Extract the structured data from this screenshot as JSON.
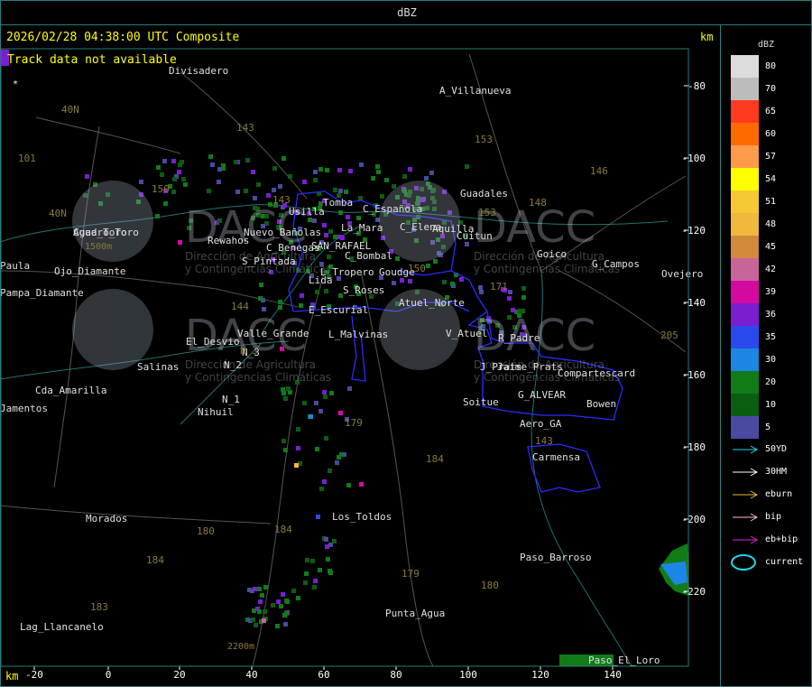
{
  "header": {
    "title": "dBZ"
  },
  "map": {
    "timestamp": "2026/02/28 04:38:00 UTC Composite",
    "track_message": "Track data not available",
    "km_unit": "km",
    "watermark": {
      "brand": "DACC",
      "line1": "Dirección de Agricultura",
      "line2": "y Contingencias Climáticas"
    },
    "x_ticks": [
      "-20",
      "0",
      "20",
      "40",
      "60",
      "80",
      "100",
      "120",
      "140"
    ],
    "y_ticks": [
      "-80",
      "-100",
      "-120",
      "-140",
      "-160",
      "-180",
      "-200",
      "-220"
    ],
    "places": [
      "Divisadero",
      "A_Villanueva",
      "Guadales",
      "Tomba",
      "Usilla",
      "C_Española",
      "La_Mara",
      "C_Elena",
      "Cuadro_Toro",
      "Nuevo_Bañolas",
      "Rewahos",
      "S_Pintada",
      "C_Benegas",
      "SAN_RAFAEL",
      "C_Bombal",
      "Goudge",
      "Lida",
      "L_Tropero",
      "S_Roses",
      "Atuel_Norte",
      "E_Escurial",
      "Valle_Grande",
      "L_Malvinas",
      "V_Atuel",
      "R_Padre",
      "J_Prats",
      "Compartescard",
      "G_ALVEAR",
      "Bowen",
      "Soitue",
      "Aero_GA",
      "Carmensa",
      "El_Desvio",
      "Salinas",
      "N_3",
      "N_2",
      "N_1",
      "Nihuil",
      "Cda_Amarilla",
      "Jamentos",
      "Pampa_Diamante",
      "Paula",
      "Agua_Toro",
      "Ojo_Diamante",
      "Morados",
      "Los_Toldos",
      "Paso_Barroso",
      "Punta_Agua",
      "Paso_El_Loro",
      "Lag_Llancanelo",
      "Goico",
      "G_Campos",
      "Ovejero",
      "Cuitun",
      "Aquilla",
      "Jaime_Prats"
    ],
    "contours": [
      "40N",
      "40N",
      "101",
      "143",
      "150",
      "153",
      "146",
      "148",
      "143",
      "150",
      "171",
      "144",
      "205",
      "179",
      "184",
      "180",
      "184",
      "179",
      "180",
      "183",
      "184",
      "143",
      "153",
      "N_3"
    ],
    "elevation_labels": [
      "1500m",
      "2200m"
    ],
    "colors": {
      "frame": "#2a7d7d",
      "boundary": "#2b2bff",
      "text_yellow": "#ffff00",
      "place_text": "#e0e0e0",
      "contour_text": "#8a7a3a"
    }
  },
  "legend": {
    "title": "dBZ",
    "scale": [
      {
        "value": "80",
        "color": "#dcdcdc"
      },
      {
        "value": "70",
        "color": "#bcbcbc"
      },
      {
        "value": "65",
        "color": "#ff3a1e"
      },
      {
        "value": "60",
        "color": "#ff6a00"
      },
      {
        "value": "57",
        "color": "#ff9a4a"
      },
      {
        "value": "54",
        "color": "#ffff00"
      },
      {
        "value": "51",
        "color": "#f6c834"
      },
      {
        "value": "48",
        "color": "#f0b83c"
      },
      {
        "value": "45",
        "color": "#d08a3a"
      },
      {
        "value": "42",
        "color": "#c8649a"
      },
      {
        "value": "39",
        "color": "#d40aa0"
      },
      {
        "value": "36",
        "color": "#7a1ed0"
      },
      {
        "value": "35",
        "color": "#2a4aee"
      },
      {
        "value": "30",
        "color": "#1c86e4"
      },
      {
        "value": "20",
        "color": "#117b1a"
      },
      {
        "value": "10",
        "color": "#0a5e12"
      },
      {
        "value": "5",
        "color": "#4a4aa0"
      }
    ],
    "tracks": [
      {
        "label": "50YD",
        "color": "#22d8e8",
        "icon": "arrow-icon"
      },
      {
        "label": "30HM",
        "color": "#ffffff",
        "icon": "arrow-icon"
      },
      {
        "label": "eburn",
        "color": "#f0b840",
        "icon": "arrow-icon"
      },
      {
        "label": "bip",
        "color": "#ffb8d8",
        "icon": "arrow-icon"
      },
      {
        "label": "eb+bip",
        "color": "#e020e0",
        "icon": "arrow-icon"
      },
      {
        "label": "current",
        "color": "#22d8e8",
        "icon": "ellipse-icon"
      }
    ]
  }
}
